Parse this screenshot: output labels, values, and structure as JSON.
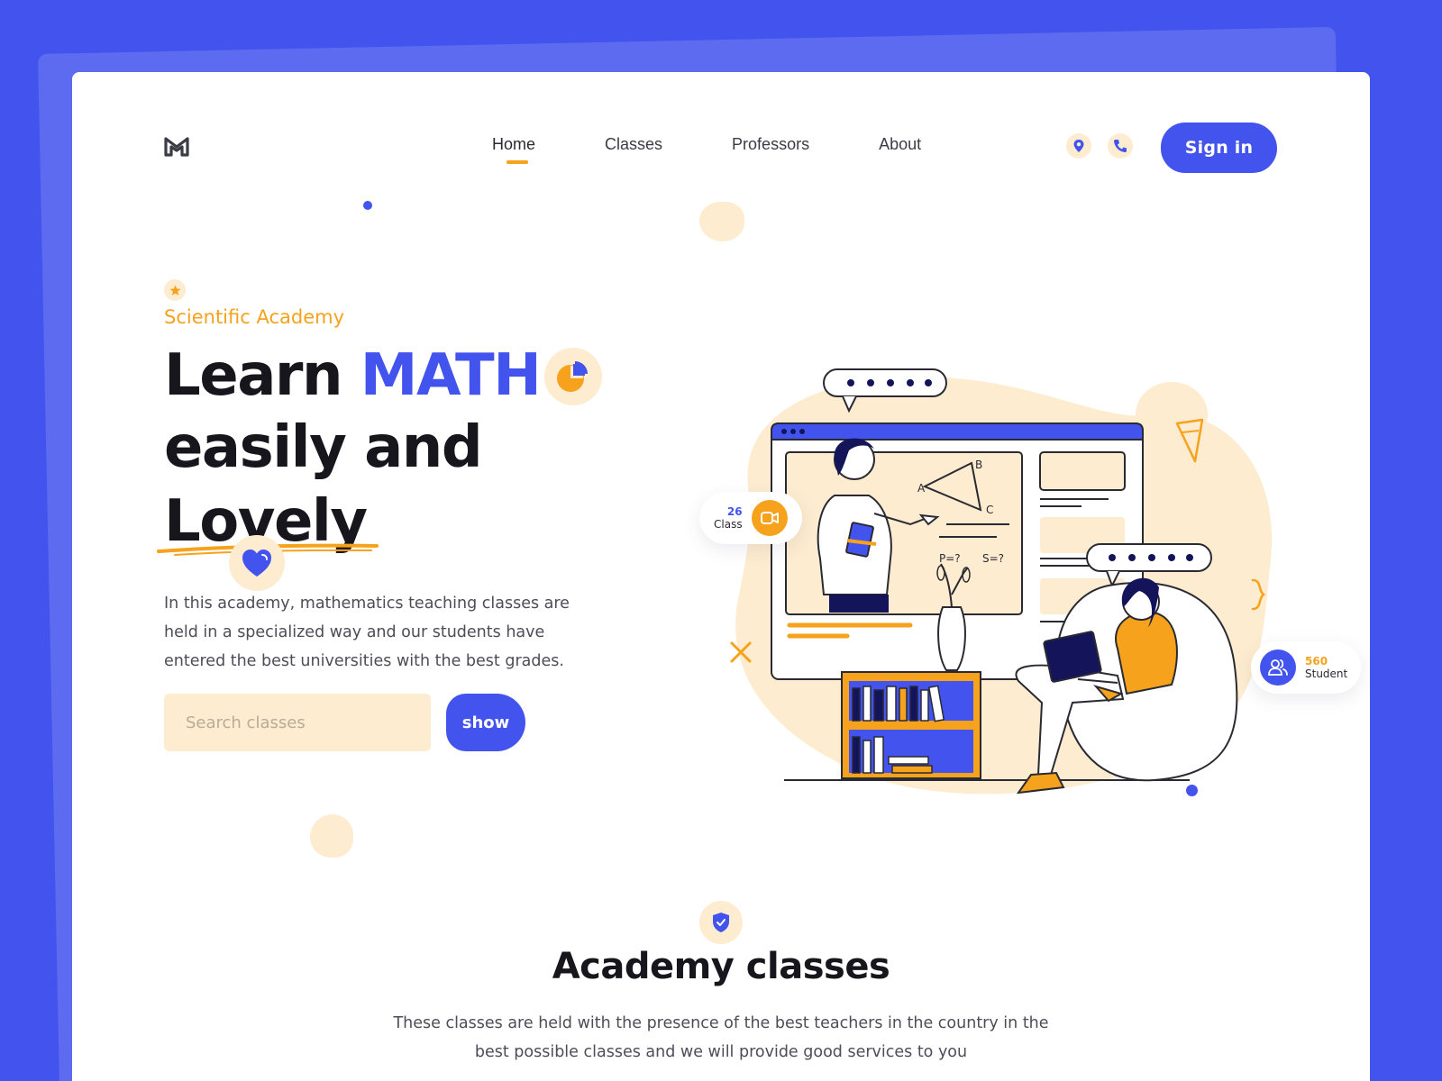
{
  "nav": {
    "items": [
      {
        "label": "Home",
        "active": true
      },
      {
        "label": "Classes",
        "active": false
      },
      {
        "label": "Professors",
        "active": false
      },
      {
        "label": "About",
        "active": false
      }
    ],
    "signin_label": "Sign in",
    "icons": [
      "location-icon",
      "phone-icon"
    ]
  },
  "hero": {
    "eyebrow": "Scientific Academy",
    "title_line1_prefix": "Learn ",
    "title_line1_accent": "MATH",
    "title_line2": "easily and",
    "title_line3": "Lovely",
    "description": "In this academy, mathematics teaching classes are held in a specialized way and our students have entered the best universities with the best grades.",
    "search_placeholder": "Search classes",
    "search_value": "",
    "show_label": "show"
  },
  "illustration": {
    "class_badge": {
      "number": "26",
      "label": "Class"
    },
    "student_badge": {
      "number": "560",
      "label": "Student"
    },
    "board_labels": [
      "A",
      "B",
      "C"
    ],
    "board_formulas": [
      "P=?",
      "S=?"
    ]
  },
  "section": {
    "title": "Academy classes",
    "description": "These classes are held with the presence of the best teachers in the country in the best possible classes and we will provide good services to you"
  },
  "colors": {
    "primary": "#4353ee",
    "accent": "#f6a21c",
    "cream": "#fdeccf",
    "text": "#16161c"
  }
}
